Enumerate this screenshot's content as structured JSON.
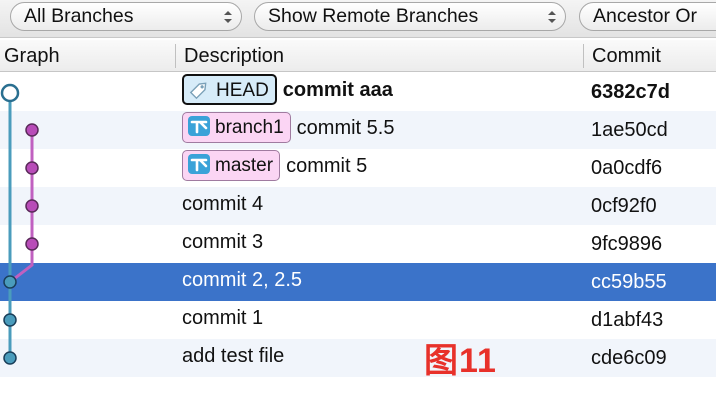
{
  "toolbar": {
    "branches_select": "All Branches",
    "remote_select": "Show Remote Branches",
    "ancestor_select": "Ancestor Or"
  },
  "columns": {
    "graph": "Graph",
    "description": "Description",
    "commit": "Commit"
  },
  "rows": [
    {
      "badge": "HEAD",
      "badge_type": "tag",
      "message": "commit aaa",
      "commit": "6382c7d"
    },
    {
      "badge": "branch1",
      "badge_type": "branch",
      "message": "commit 5.5",
      "commit": "1ae50cd"
    },
    {
      "badge": "master",
      "badge_type": "branch",
      "message": "commit 5",
      "commit": "0a0cdf6"
    },
    {
      "message": "commit 4",
      "commit": "0cf92f0"
    },
    {
      "message": "commit 3",
      "commit": "9fc9896"
    },
    {
      "message": "commit 2, 2.5",
      "commit": "cc59b55",
      "selected": true
    },
    {
      "message": "commit 1",
      "commit": "d1abf43"
    },
    {
      "message": "add test file",
      "commit": "cde6c09"
    }
  ],
  "graph": {
    "main_lane_color": "#4a9cbc",
    "branch_lane_color": "#c060c0"
  },
  "colors": {
    "selection": "#3b73c9",
    "head_badge": "#d7ecf9",
    "branch_badge": "#fbd5f4"
  },
  "watermark": "图11"
}
